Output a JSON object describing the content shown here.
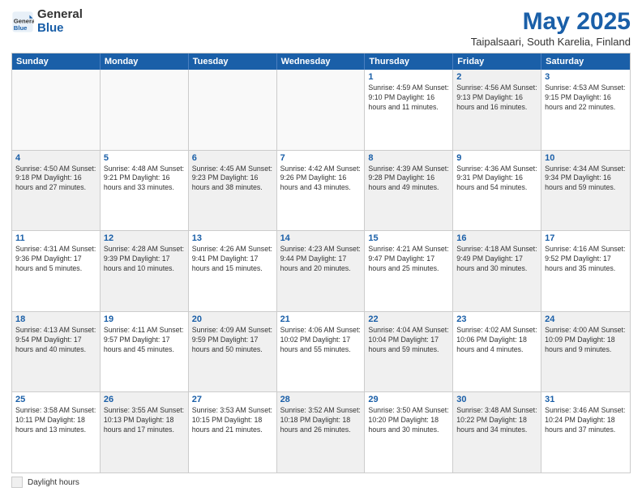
{
  "header": {
    "logo_general": "General",
    "logo_blue": "Blue",
    "title": "May 2025",
    "subtitle": "Taipalsaari, South Karelia, Finland"
  },
  "calendar": {
    "days_of_week": [
      "Sunday",
      "Monday",
      "Tuesday",
      "Wednesday",
      "Thursday",
      "Friday",
      "Saturday"
    ],
    "legend_label": "Daylight hours"
  },
  "rows": [
    [
      {
        "day": "",
        "text": "",
        "empty": true
      },
      {
        "day": "",
        "text": "",
        "empty": true
      },
      {
        "day": "",
        "text": "",
        "empty": true
      },
      {
        "day": "",
        "text": "",
        "empty": true
      },
      {
        "day": "1",
        "text": "Sunrise: 4:59 AM\nSunset: 9:10 PM\nDaylight: 16 hours\nand 11 minutes.",
        "shaded": false
      },
      {
        "day": "2",
        "text": "Sunrise: 4:56 AM\nSunset: 9:13 PM\nDaylight: 16 hours\nand 16 minutes.",
        "shaded": true
      },
      {
        "day": "3",
        "text": "Sunrise: 4:53 AM\nSunset: 9:15 PM\nDaylight: 16 hours\nand 22 minutes.",
        "shaded": false
      }
    ],
    [
      {
        "day": "4",
        "text": "Sunrise: 4:50 AM\nSunset: 9:18 PM\nDaylight: 16 hours\nand 27 minutes.",
        "shaded": true
      },
      {
        "day": "5",
        "text": "Sunrise: 4:48 AM\nSunset: 9:21 PM\nDaylight: 16 hours\nand 33 minutes.",
        "shaded": false
      },
      {
        "day": "6",
        "text": "Sunrise: 4:45 AM\nSunset: 9:23 PM\nDaylight: 16 hours\nand 38 minutes.",
        "shaded": true
      },
      {
        "day": "7",
        "text": "Sunrise: 4:42 AM\nSunset: 9:26 PM\nDaylight: 16 hours\nand 43 minutes.",
        "shaded": false
      },
      {
        "day": "8",
        "text": "Sunrise: 4:39 AM\nSunset: 9:28 PM\nDaylight: 16 hours\nand 49 minutes.",
        "shaded": true
      },
      {
        "day": "9",
        "text": "Sunrise: 4:36 AM\nSunset: 9:31 PM\nDaylight: 16 hours\nand 54 minutes.",
        "shaded": false
      },
      {
        "day": "10",
        "text": "Sunrise: 4:34 AM\nSunset: 9:34 PM\nDaylight: 16 hours\nand 59 minutes.",
        "shaded": true
      }
    ],
    [
      {
        "day": "11",
        "text": "Sunrise: 4:31 AM\nSunset: 9:36 PM\nDaylight: 17 hours\nand 5 minutes.",
        "shaded": false
      },
      {
        "day": "12",
        "text": "Sunrise: 4:28 AM\nSunset: 9:39 PM\nDaylight: 17 hours\nand 10 minutes.",
        "shaded": true
      },
      {
        "day": "13",
        "text": "Sunrise: 4:26 AM\nSunset: 9:41 PM\nDaylight: 17 hours\nand 15 minutes.",
        "shaded": false
      },
      {
        "day": "14",
        "text": "Sunrise: 4:23 AM\nSunset: 9:44 PM\nDaylight: 17 hours\nand 20 minutes.",
        "shaded": true
      },
      {
        "day": "15",
        "text": "Sunrise: 4:21 AM\nSunset: 9:47 PM\nDaylight: 17 hours\nand 25 minutes.",
        "shaded": false
      },
      {
        "day": "16",
        "text": "Sunrise: 4:18 AM\nSunset: 9:49 PM\nDaylight: 17 hours\nand 30 minutes.",
        "shaded": true
      },
      {
        "day": "17",
        "text": "Sunrise: 4:16 AM\nSunset: 9:52 PM\nDaylight: 17 hours\nand 35 minutes.",
        "shaded": false
      }
    ],
    [
      {
        "day": "18",
        "text": "Sunrise: 4:13 AM\nSunset: 9:54 PM\nDaylight: 17 hours\nand 40 minutes.",
        "shaded": true
      },
      {
        "day": "19",
        "text": "Sunrise: 4:11 AM\nSunset: 9:57 PM\nDaylight: 17 hours\nand 45 minutes.",
        "shaded": false
      },
      {
        "day": "20",
        "text": "Sunrise: 4:09 AM\nSunset: 9:59 PM\nDaylight: 17 hours\nand 50 minutes.",
        "shaded": true
      },
      {
        "day": "21",
        "text": "Sunrise: 4:06 AM\nSunset: 10:02 PM\nDaylight: 17 hours\nand 55 minutes.",
        "shaded": false
      },
      {
        "day": "22",
        "text": "Sunrise: 4:04 AM\nSunset: 10:04 PM\nDaylight: 17 hours\nand 59 minutes.",
        "shaded": true
      },
      {
        "day": "23",
        "text": "Sunrise: 4:02 AM\nSunset: 10:06 PM\nDaylight: 18 hours\nand 4 minutes.",
        "shaded": false
      },
      {
        "day": "24",
        "text": "Sunrise: 4:00 AM\nSunset: 10:09 PM\nDaylight: 18 hours\nand 9 minutes.",
        "shaded": true
      }
    ],
    [
      {
        "day": "25",
        "text": "Sunrise: 3:58 AM\nSunset: 10:11 PM\nDaylight: 18 hours\nand 13 minutes.",
        "shaded": false
      },
      {
        "day": "26",
        "text": "Sunrise: 3:55 AM\nSunset: 10:13 PM\nDaylight: 18 hours\nand 17 minutes.",
        "shaded": true
      },
      {
        "day": "27",
        "text": "Sunrise: 3:53 AM\nSunset: 10:15 PM\nDaylight: 18 hours\nand 21 minutes.",
        "shaded": false
      },
      {
        "day": "28",
        "text": "Sunrise: 3:52 AM\nSunset: 10:18 PM\nDaylight: 18 hours\nand 26 minutes.",
        "shaded": true
      },
      {
        "day": "29",
        "text": "Sunrise: 3:50 AM\nSunset: 10:20 PM\nDaylight: 18 hours\nand 30 minutes.",
        "shaded": false
      },
      {
        "day": "30",
        "text": "Sunrise: 3:48 AM\nSunset: 10:22 PM\nDaylight: 18 hours\nand 34 minutes.",
        "shaded": true
      },
      {
        "day": "31",
        "text": "Sunrise: 3:46 AM\nSunset: 10:24 PM\nDaylight: 18 hours\nand 37 minutes.",
        "shaded": false
      }
    ]
  ]
}
